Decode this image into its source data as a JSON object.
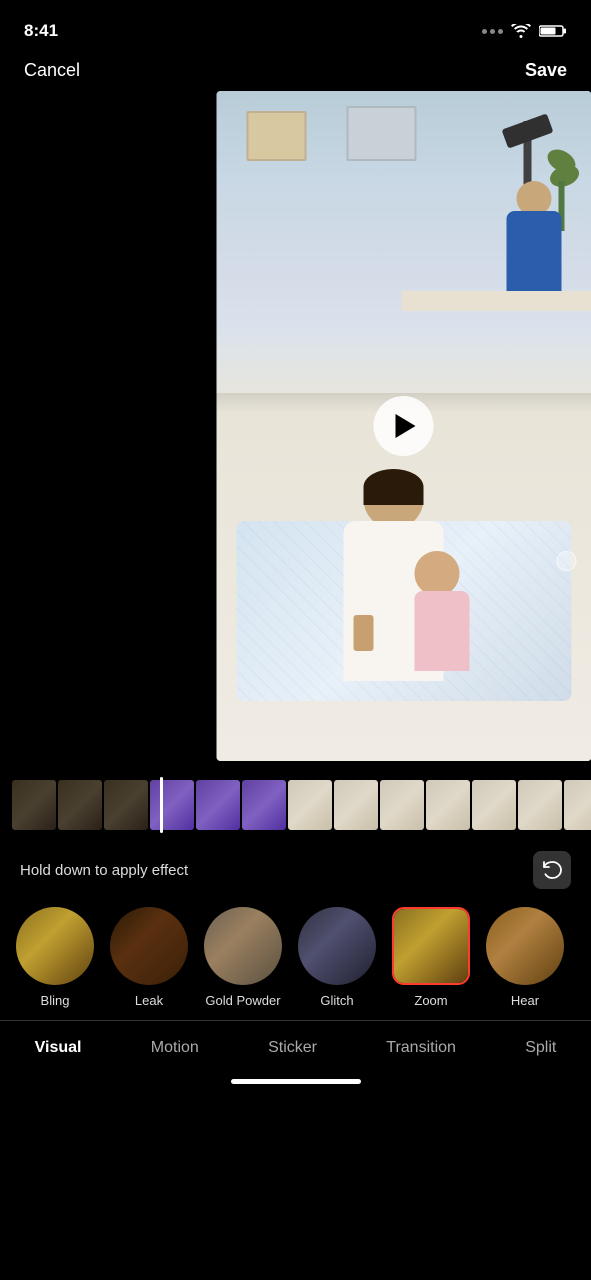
{
  "statusBar": {
    "time": "8:41",
    "dots": [
      "•",
      "•",
      "•"
    ],
    "wifiLabel": "wifi",
    "batteryLabel": "battery"
  },
  "header": {
    "cancel": "Cancel",
    "save": "Save"
  },
  "videoArea": {
    "playButtonLabel": "Play"
  },
  "timeline": {
    "holdText": "Hold down to apply effect",
    "undoLabel": "Undo"
  },
  "effects": [
    {
      "id": "bling",
      "label": "Bling",
      "selected": false,
      "thumbClass": "thumb-bling"
    },
    {
      "id": "leak",
      "label": "Leak",
      "selected": false,
      "thumbClass": "thumb-leak"
    },
    {
      "id": "gold-powder",
      "label": "Gold Powder",
      "selected": false,
      "thumbClass": "thumb-gold-powder"
    },
    {
      "id": "glitch",
      "label": "Glitch",
      "selected": false,
      "thumbClass": "thumb-glitch"
    },
    {
      "id": "zoom",
      "label": "Zoom",
      "selected": true,
      "thumbClass": "thumb-zoom"
    },
    {
      "id": "hear",
      "label": "Hear",
      "selected": false,
      "thumbClass": "thumb-hear"
    }
  ],
  "tabs": [
    {
      "id": "visual",
      "label": "Visual",
      "active": true
    },
    {
      "id": "motion",
      "label": "Motion",
      "active": false
    },
    {
      "id": "sticker",
      "label": "Sticker",
      "active": false
    },
    {
      "id": "transition",
      "label": "Transition",
      "active": false
    },
    {
      "id": "split",
      "label": "Split",
      "active": false
    }
  ],
  "colors": {
    "accent": "#ff3b30",
    "bg": "#000000",
    "tabActive": "#ffffff",
    "tabInactive": "#aaaaaa"
  }
}
